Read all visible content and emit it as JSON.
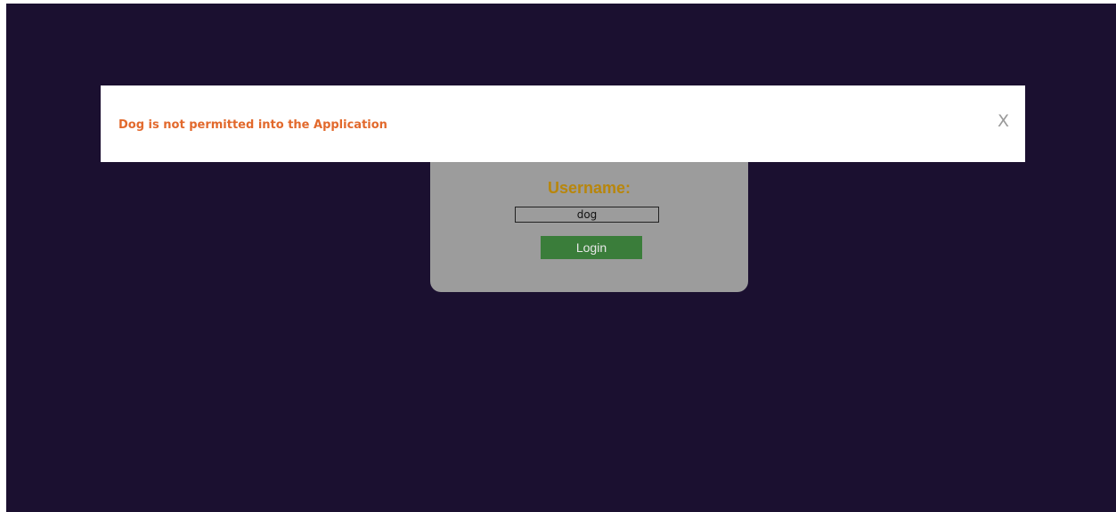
{
  "alert": {
    "message": "Dog is not permitted into the Application",
    "close_glyph": "X"
  },
  "login": {
    "username_label": "Username:",
    "username_value": "dog",
    "login_label": "Login"
  },
  "colors": {
    "background": "#1b1030",
    "card": "#9c9c9c",
    "label": "#b8860b",
    "button": "#3a7d3a",
    "alert_text": "#e2692c"
  }
}
